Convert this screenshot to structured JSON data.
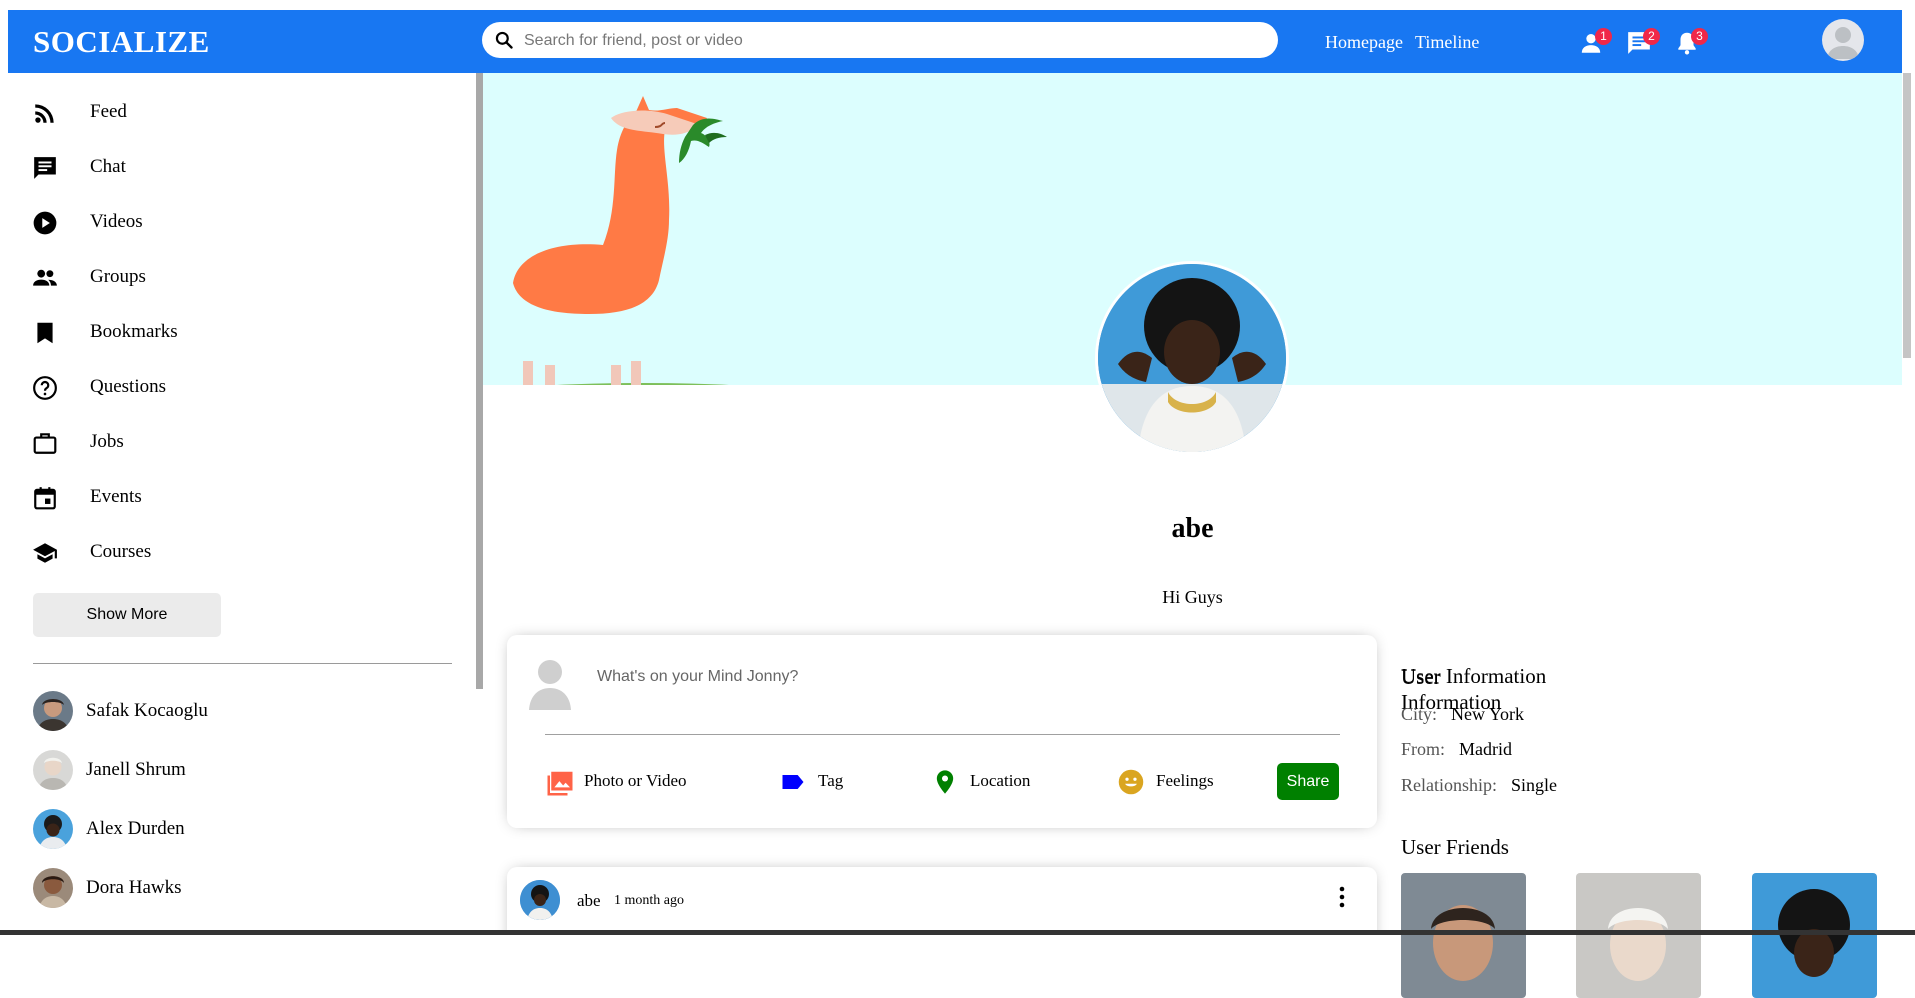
{
  "app": {
    "logo": "SOCIALIZE"
  },
  "topbar": {
    "search_placeholder": "Search for friend, post or video",
    "links": [
      "Homepage",
      "Timeline"
    ],
    "badges": {
      "friends": "1",
      "messages": "2",
      "notifications": "3"
    }
  },
  "sidebar": {
    "items": [
      {
        "label": "Feed",
        "icon": "rss-icon"
      },
      {
        "label": "Chat",
        "icon": "chat-icon"
      },
      {
        "label": "Videos",
        "icon": "play-circle-icon"
      },
      {
        "label": "Groups",
        "icon": "group-icon"
      },
      {
        "label": "Bookmarks",
        "icon": "bookmark-icon"
      },
      {
        "label": "Questions",
        "icon": "help-circle-icon"
      },
      {
        "label": "Jobs",
        "icon": "briefcase-icon"
      },
      {
        "label": "Events",
        "icon": "calendar-icon"
      },
      {
        "label": "Courses",
        "icon": "school-icon"
      }
    ],
    "show_more": "Show More",
    "friends": [
      "Safak Kocaoglu",
      "Janell Shrum",
      "Alex Durden",
      "Dora Hawks"
    ]
  },
  "profile": {
    "name": "abe",
    "description": "Hi Guys"
  },
  "share": {
    "placeholder": "What's on your Mind Jonny?",
    "options": [
      "Photo or Video",
      "Tag",
      "Location",
      "Feelings"
    ],
    "button": "Share",
    "colors": {
      "photo": "#ff6347",
      "tag": "#0000ff",
      "location": "#008000",
      "feelings": "#daa520",
      "share": "#008000"
    }
  },
  "post": {
    "username": "abe",
    "date": "1 month ago"
  },
  "user_info": {
    "title": "User Information",
    "rows": [
      {
        "key": "City:",
        "value": "New York"
      },
      {
        "key": "From:",
        "value": "Madrid"
      },
      {
        "key": "Relationship:",
        "value": "Single"
      }
    ],
    "friends_title": "User Friends"
  },
  "colors": {
    "accent": "#1877f2",
    "badge": "#f02849",
    "cover": "#dcfefe"
  }
}
